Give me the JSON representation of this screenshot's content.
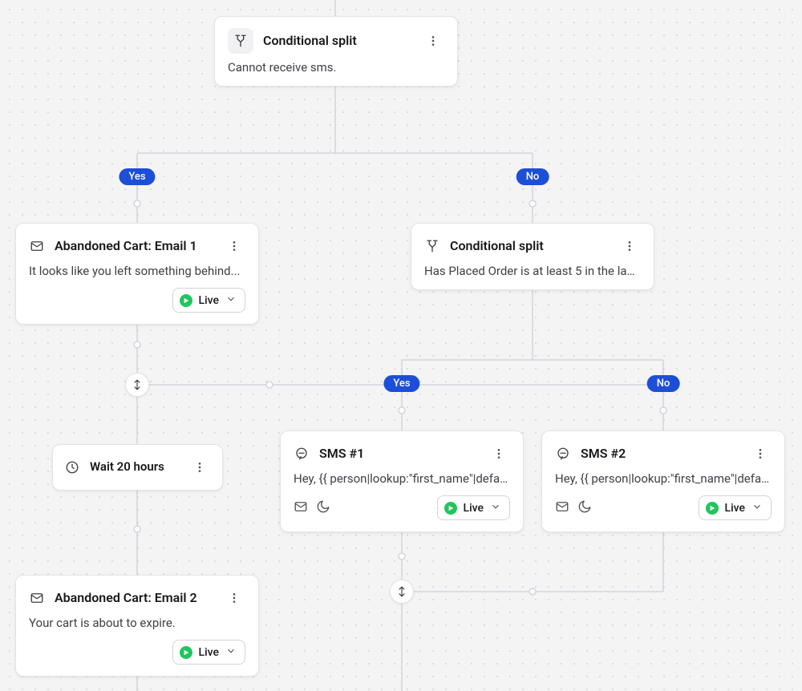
{
  "labels": {
    "yes": "Yes",
    "no": "No"
  },
  "status": {
    "live": "Live"
  },
  "nodes": {
    "top_split": {
      "title": "Conditional split",
      "description": "Cannot receive sms."
    },
    "email1": {
      "title": "Abandoned Cart: Email 1",
      "description": "It looks like you left something behind..."
    },
    "wait": {
      "title": "Wait 20 hours"
    },
    "email2": {
      "title": "Abandoned Cart: Email 2",
      "description": "Your cart is about to expire."
    },
    "right_split": {
      "title": "Conditional split",
      "description": "Has Placed Order is at least 5 in the last …"
    },
    "sms1": {
      "title": "SMS #1",
      "description": "Hey, {{ person|lookup:\"first_name\"|defaul…"
    },
    "sms2": {
      "title": "SMS #2",
      "description": "Hey, {{ person|lookup:\"first_name\"|defaul…"
    }
  }
}
